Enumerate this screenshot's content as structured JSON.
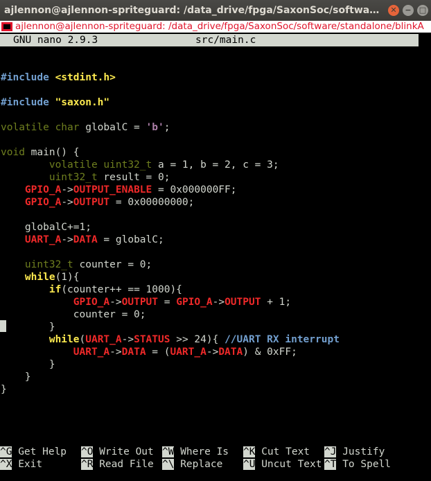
{
  "window": {
    "title": "ajlennon@ajlennon-spriteguard: /data_drive/fpga/SaxonSoc/software/stan...",
    "tab_title": "ajlennon@ajlennon-spriteguard: /data_drive/fpga/SaxonSoc/software/standalone/blinkA",
    "close_glyph": "✕",
    "minimize_glyph": "−",
    "maximize_glyph": "□"
  },
  "nano": {
    "version": "GNU nano 2.9.3",
    "filename": "src/main.c"
  },
  "code_lines": [
    [],
    [
      {
        "t": "#include ",
        "k": "c"
      },
      {
        "t": "<stdint.h>",
        "k": "y"
      }
    ],
    [],
    [
      {
        "t": "#include ",
        "k": "c"
      },
      {
        "t": "\"saxon.h\"",
        "k": "y"
      }
    ],
    [],
    [
      {
        "t": "volatile char ",
        "k": "g"
      },
      {
        "t": "globalC = ",
        "k": "w"
      },
      {
        "t": "'b'",
        "k": "m"
      },
      {
        "t": ";",
        "k": "w"
      }
    ],
    [],
    [
      {
        "t": "void ",
        "k": "g"
      },
      {
        "t": "main() {",
        "k": "w"
      }
    ],
    [
      {
        "t": "        ",
        "k": "w"
      },
      {
        "t": "volatile uint32_t ",
        "k": "g"
      },
      {
        "t": "a = 1, b = 2, c = 3;",
        "k": "w"
      }
    ],
    [
      {
        "t": "        ",
        "k": "w"
      },
      {
        "t": "uint32_t ",
        "k": "g"
      },
      {
        "t": "result = 0;",
        "k": "w"
      }
    ],
    [
      {
        "t": "    ",
        "k": "w"
      },
      {
        "t": "GPIO_A",
        "k": "r"
      },
      {
        "t": "->",
        "k": "w"
      },
      {
        "t": "OUTPUT_ENABLE",
        "k": "r"
      },
      {
        "t": " = 0x000000FF;",
        "k": "w"
      }
    ],
    [
      {
        "t": "    ",
        "k": "w"
      },
      {
        "t": "GPIO_A",
        "k": "r"
      },
      {
        "t": "->",
        "k": "w"
      },
      {
        "t": "OUTPUT",
        "k": "r"
      },
      {
        "t": " = 0x00000000;",
        "k": "w"
      }
    ],
    [],
    [
      {
        "t": "    globalC+=1;",
        "k": "w"
      }
    ],
    [
      {
        "t": "    ",
        "k": "w"
      },
      {
        "t": "UART_A",
        "k": "r"
      },
      {
        "t": "->",
        "k": "w"
      },
      {
        "t": "DATA",
        "k": "r"
      },
      {
        "t": " = globalC;",
        "k": "w"
      }
    ],
    [],
    [
      {
        "t": "    ",
        "k": "w"
      },
      {
        "t": "uint32_t ",
        "k": "g"
      },
      {
        "t": "counter = 0;",
        "k": "w"
      }
    ],
    [
      {
        "t": "    ",
        "k": "w"
      },
      {
        "t": "while",
        "k": "y"
      },
      {
        "t": "(1){",
        "k": "w"
      }
    ],
    [
      {
        "t": "        ",
        "k": "w"
      },
      {
        "t": "if",
        "k": "y"
      },
      {
        "t": "(counter++ == 1000){",
        "k": "w"
      }
    ],
    [
      {
        "t": "            ",
        "k": "w"
      },
      {
        "t": "GPIO_A",
        "k": "r"
      },
      {
        "t": "->",
        "k": "w"
      },
      {
        "t": "OUTPUT",
        "k": "r"
      },
      {
        "t": " = ",
        "k": "w"
      },
      {
        "t": "GPIO_A",
        "k": "r"
      },
      {
        "t": "->",
        "k": "w"
      },
      {
        "t": "OUTPUT",
        "k": "r"
      },
      {
        "t": " + 1;",
        "k": "w"
      }
    ],
    [
      {
        "t": "            counter = 0;",
        "k": "w"
      }
    ],
    [
      {
        "t": "        }",
        "k": "w"
      }
    ],
    [
      {
        "t": "        ",
        "k": "w"
      },
      {
        "t": "while",
        "k": "y"
      },
      {
        "t": "(",
        "k": "w"
      },
      {
        "t": "UART_A",
        "k": "r"
      },
      {
        "t": "->",
        "k": "w"
      },
      {
        "t": "STATUS",
        "k": "r"
      },
      {
        "t": " >> 24){ ",
        "k": "w"
      },
      {
        "t": "//UART RX interrupt",
        "k": "c"
      }
    ],
    [
      {
        "t": "            ",
        "k": "w"
      },
      {
        "t": "UART_A",
        "k": "r"
      },
      {
        "t": "->",
        "k": "w"
      },
      {
        "t": "DATA",
        "k": "r"
      },
      {
        "t": " = (",
        "k": "w"
      },
      {
        "t": "UART_A",
        "k": "r"
      },
      {
        "t": "->",
        "k": "w"
      },
      {
        "t": "DATA",
        "k": "r"
      },
      {
        "t": ") & 0xFF;",
        "k": "w"
      }
    ],
    [
      {
        "t": "        }",
        "k": "w"
      }
    ],
    [
      {
        "t": "    }",
        "k": "w"
      }
    ],
    [
      {
        "t": "}",
        "k": "w"
      }
    ]
  ],
  "shortcuts_row1": [
    {
      "key": "^G",
      "label": "Get Help"
    },
    {
      "key": "^O",
      "label": "Write Out"
    },
    {
      "key": "^W",
      "label": "Where Is"
    },
    {
      "key": "^K",
      "label": "Cut Text"
    },
    {
      "key": "^J",
      "label": "Justify"
    }
  ],
  "shortcuts_row2": [
    {
      "key": "^X",
      "label": "Exit"
    },
    {
      "key": "^R",
      "label": "Read File"
    },
    {
      "key": "^\\",
      "label": "Replace"
    },
    {
      "key": "^U",
      "label": "Uncut Text"
    },
    {
      "key": "^T",
      "label": "To Spell"
    }
  ]
}
